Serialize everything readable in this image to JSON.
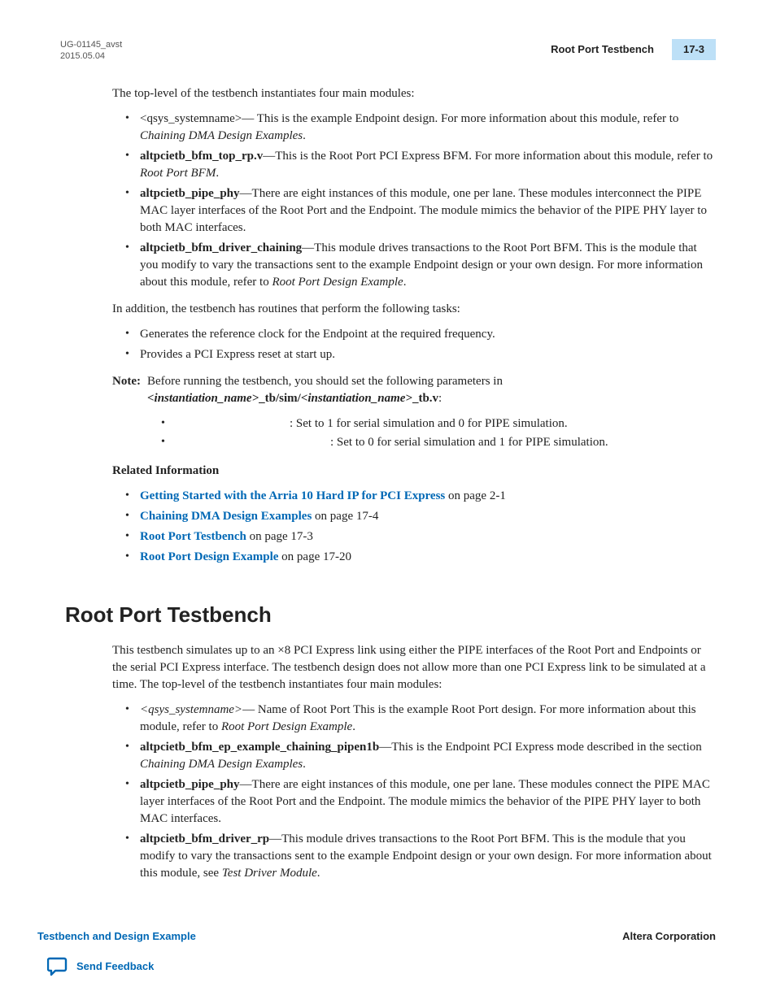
{
  "header": {
    "doc_id_line1": "UG-01145_avst",
    "doc_id_line2": "2015.05.04",
    "section_title": "Root Port Testbench",
    "page_number": "17-3"
  },
  "intro_para": "The top-level of the testbench instantiates four main modules:",
  "modules1": [
    {
      "term": "<qsys_systemname>",
      "sep": "— ",
      "desc_pre": "This is the example Endpoint design. For more information about this module, refer to ",
      "desc_italic": "Chaining DMA Design Examples",
      "desc_post": "."
    },
    {
      "term": "altpcietb_bfm_top_rp.v",
      "sep": "—",
      "desc_pre": "This is the Root Port PCI Express BFM. For more information about this module, refer to ",
      "desc_italic": "Root Port BFM",
      "desc_post": "."
    },
    {
      "term": "altpcietb_pipe_phy",
      "sep": "—",
      "desc_pre": "There are eight instances of this module, one per lane. These modules interconnect the PIPE MAC layer interfaces of the Root Port and the Endpoint. The module mimics the behavior of the PIPE PHY layer to both MAC interfaces.",
      "desc_italic": "",
      "desc_post": ""
    },
    {
      "term": "altpcietb_bfm_driver_chaining",
      "sep": "—",
      "desc_pre": "This module drives transactions to the Root Port BFM. This is the module that you modify to vary the transactions sent to the example Endpoint design or your own design. For more information about this module, refer to ",
      "desc_italic": "Root Port Design Example",
      "desc_post": "."
    }
  ],
  "addition_para": "In addition, the testbench has routines that perform the following tasks:",
  "tasks": [
    "Generates the reference clock for the Endpoint at the required frequency.",
    "Provides a PCI Express reset at start up."
  ],
  "note": {
    "label": "Note:",
    "pre": "Before running the testbench, you should set the following parameters in ",
    "b1": "<instantiation_name>",
    "mid1": "_tb/sim/",
    "b2": "<instantiation_name>",
    "mid2": "_tb.v",
    "post": ":"
  },
  "params": [
    ": Set to 1 for serial simulation and 0 for PIPE simulation.",
    ": Set to 0 for serial simulation and 1 for PIPE simulation."
  ],
  "related_info_hdr": "Related Information",
  "related": [
    {
      "link": "Getting Started with the Arria 10 Hard IP for PCI Express",
      "suffix": " on page 2-1"
    },
    {
      "link": "Chaining DMA Design Examples",
      "suffix": " on page 17-4"
    },
    {
      "link": "Root Port Testbench",
      "suffix": " on page 17-3"
    },
    {
      "link": "Root Port Design Example",
      "suffix": " on page 17-20"
    }
  ],
  "section2_heading": "Root Port Testbench",
  "section2_para": "This testbench simulates up to an ×8 PCI Express link using either the PIPE interfaces of the Root Port and Endpoints or the serial PCI Express interface. The testbench design does not allow more than one PCI Express link to be simulated at a time. The top-level of the testbench instantiates four main modules:",
  "modules2": [
    {
      "term_italic": "<qsys_systemname>",
      "sep": "— ",
      "desc_pre": "Name of Root Port This is the example Root Port design. For more information about this module, refer to ",
      "desc_italic": "Root Port Design Example",
      "desc_post": "."
    },
    {
      "term": "altpcietb_bfm_ep_example_chaining_pipen1b",
      "sep": "—",
      "desc_pre": "This is the Endpoint PCI Express mode described in the section ",
      "desc_italic": "Chaining DMA Design Examples",
      "desc_post": "."
    },
    {
      "term": "altpcietb_pipe_phy",
      "sep": "—",
      "desc_pre": "There are eight instances of this module, one per lane. These modules connect the PIPE MAC layer interfaces of the Root Port and the Endpoint. The module mimics the behavior of the PIPE PHY layer to both MAC interfaces.",
      "desc_italic": "",
      "desc_post": ""
    },
    {
      "term": "altpcietb_bfm_driver_rp",
      "sep": "—",
      "desc_pre": "This module drives transactions to the Root Port BFM. This is the module that you modify to vary the transactions sent to the example Endpoint design or your own design. For more information about this module, see ",
      "desc_italic": "Test Driver Module",
      "desc_post": "."
    }
  ],
  "footer": {
    "left": "Testbench and Design Example",
    "right": "Altera Corporation",
    "feedback": "Send Feedback"
  }
}
